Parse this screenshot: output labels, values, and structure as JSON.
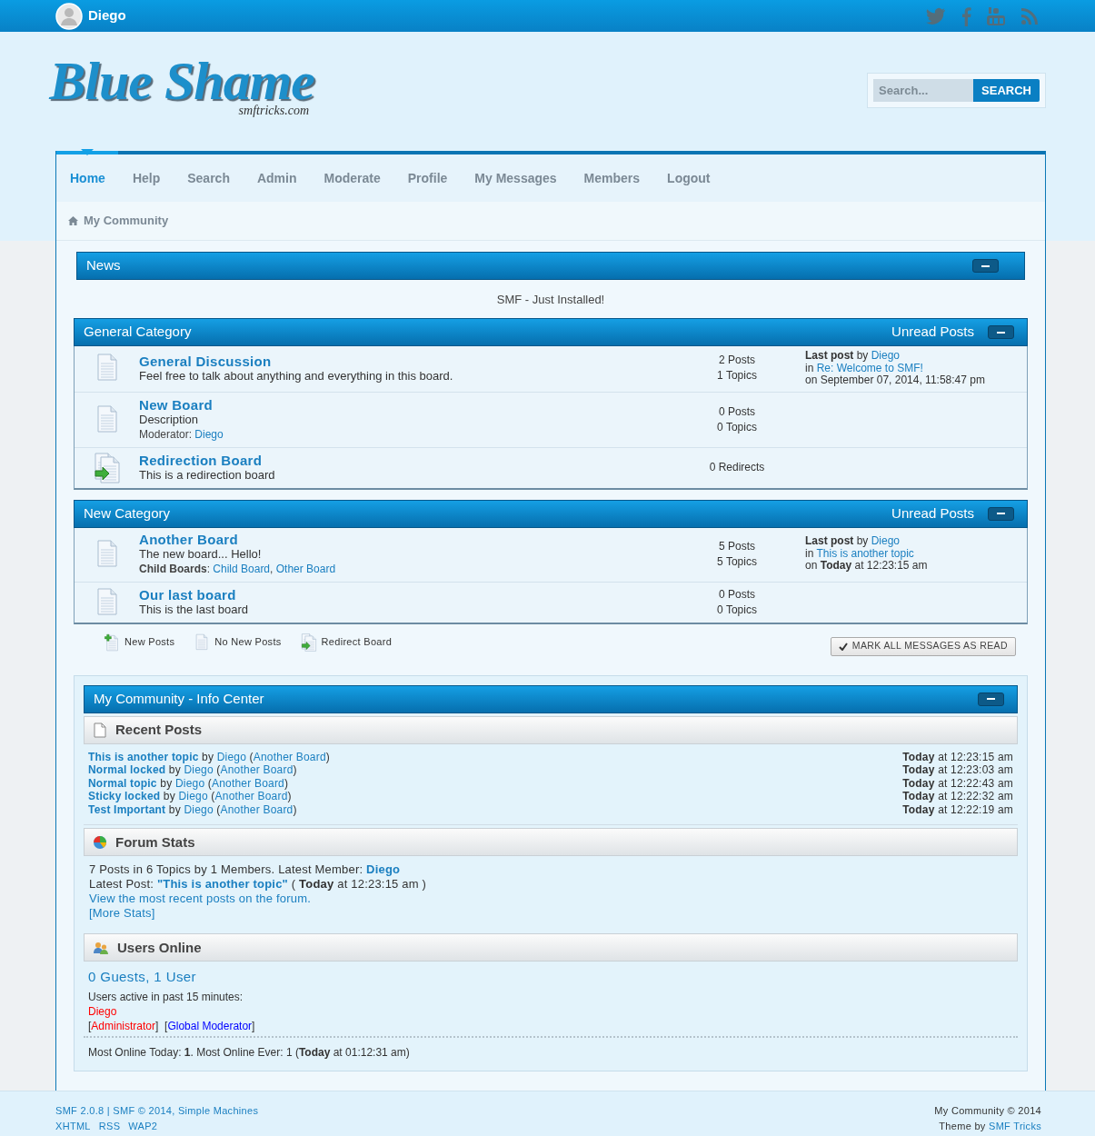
{
  "top_bar": {
    "username": "Diego"
  },
  "logo": {
    "title": "Blue Shame",
    "subtitle": "smftricks.com"
  },
  "search": {
    "placeholder": "Search...",
    "button": "SEARCH"
  },
  "nav": [
    {
      "label": "Home",
      "selected": true
    },
    {
      "label": "Help",
      "selected": false
    },
    {
      "label": "Search",
      "selected": false
    },
    {
      "label": "Admin",
      "selected": false
    },
    {
      "label": "Moderate",
      "selected": false
    },
    {
      "label": "Profile",
      "selected": false
    },
    {
      "label": "My Messages",
      "selected": false
    },
    {
      "label": "Members",
      "selected": false
    },
    {
      "label": "Logout",
      "selected": false
    }
  ],
  "breadcrumb": "My Community",
  "news": {
    "title": "News",
    "text": "SMF - Just Installed!"
  },
  "categories": [
    {
      "title": "General Category",
      "unread": "Unread Posts",
      "boards": [
        {
          "kind": "normal",
          "name": "General Discussion",
          "description": "Feel free to talk about anything and everything in this board.",
          "stats": [
            "2 Posts",
            "1 Topics"
          ],
          "last_post": [
            [
              {
                "text": "Last post",
                "kind": "bold"
              },
              {
                "text": " by ",
                "kind": "text"
              },
              {
                "text": "Diego",
                "kind": "link"
              }
            ],
            [
              {
                "text": "in ",
                "kind": "text"
              },
              {
                "text": "Re: Welcome to SMF!",
                "kind": "link"
              }
            ],
            [
              {
                "text": "on September 07, 2014, 11:58:47 pm",
                "kind": "text"
              }
            ]
          ]
        },
        {
          "kind": "normal",
          "name": "New Board",
          "description": "Description",
          "extra": [
            {
              "text": "Moderator: ",
              "kind": "text"
            },
            {
              "text": "Diego",
              "kind": "link"
            }
          ],
          "stats": [
            "0 Posts",
            "0 Topics"
          ]
        },
        {
          "kind": "redirect",
          "name": "Redirection Board",
          "description": "This is a redirection board",
          "stats": [
            "0 Redirects"
          ]
        }
      ]
    },
    {
      "title": "New Category",
      "unread": "Unread Posts",
      "boards": [
        {
          "kind": "normal",
          "name": "Another Board",
          "description": "The new board... Hello!",
          "extra": [
            {
              "text": "Child Boards",
              "kind": "bold"
            },
            {
              "text": ": ",
              "kind": "text"
            },
            {
              "text": "Child Board",
              "kind": "link"
            },
            {
              "text": ", ",
              "kind": "text"
            },
            {
              "text": "Other Board",
              "kind": "link"
            }
          ],
          "stats": [
            "5 Posts",
            "5 Topics"
          ],
          "last_post": [
            [
              {
                "text": "Last post",
                "kind": "bold"
              },
              {
                "text": " by ",
                "kind": "text"
              },
              {
                "text": "Diego",
                "kind": "link"
              }
            ],
            [
              {
                "text": "in ",
                "kind": "text"
              },
              {
                "text": "This is another topic",
                "kind": "link"
              }
            ],
            [
              {
                "text": "on ",
                "kind": "text"
              },
              {
                "text": "Today",
                "kind": "bold"
              },
              {
                "text": " at 12:23:15 am",
                "kind": "text"
              }
            ]
          ]
        },
        {
          "kind": "normal",
          "name": "Our last board",
          "description": "This is the last board",
          "stats": [
            "0 Posts",
            "0 Topics"
          ]
        }
      ]
    }
  ],
  "legend": [
    {
      "kind": "new",
      "label": "New Posts"
    },
    {
      "kind": "normal",
      "label": "No New Posts"
    },
    {
      "kind": "redirect",
      "label": "Redirect Board"
    }
  ],
  "mark_read": "MARK ALL MESSAGES AS READ",
  "info_center": {
    "title": "My Community - Info Center",
    "sections": [
      {
        "kind": "recent",
        "title": "Recent Posts",
        "posts": [
          {
            "topic": [
              {
                "text": "This is another topic",
                "kind": "linkbold"
              },
              {
                "text": " by ",
                "kind": "text"
              },
              {
                "text": "Diego",
                "kind": "link"
              },
              {
                "text": " (",
                "kind": "text"
              },
              {
                "text": "Another Board",
                "kind": "link"
              },
              {
                "text": ")",
                "kind": "text"
              }
            ],
            "time": [
              {
                "text": "Today",
                "kind": "bold"
              },
              {
                "text": " at 12:23:15 am",
                "kind": "text"
              }
            ]
          },
          {
            "topic": [
              {
                "text": "Normal locked",
                "kind": "linkbold"
              },
              {
                "text": " by ",
                "kind": "text"
              },
              {
                "text": "Diego",
                "kind": "link"
              },
              {
                "text": " (",
                "kind": "text"
              },
              {
                "text": "Another Board",
                "kind": "link"
              },
              {
                "text": ")",
                "kind": "text"
              }
            ],
            "time": [
              {
                "text": "Today",
                "kind": "bold"
              },
              {
                "text": " at 12:23:03 am",
                "kind": "text"
              }
            ]
          },
          {
            "topic": [
              {
                "text": "Normal topic",
                "kind": "linkbold"
              },
              {
                "text": " by ",
                "kind": "text"
              },
              {
                "text": "Diego",
                "kind": "link"
              },
              {
                "text": " (",
                "kind": "text"
              },
              {
                "text": "Another Board",
                "kind": "link"
              },
              {
                "text": ")",
                "kind": "text"
              }
            ],
            "time": [
              {
                "text": "Today",
                "kind": "bold"
              },
              {
                "text": " at 12:22:43 am",
                "kind": "text"
              }
            ]
          },
          {
            "topic": [
              {
                "text": "Sticky locked",
                "kind": "linkbold"
              },
              {
                "text": " by ",
                "kind": "text"
              },
              {
                "text": "Diego",
                "kind": "link"
              },
              {
                "text": " (",
                "kind": "text"
              },
              {
                "text": "Another Board",
                "kind": "link"
              },
              {
                "text": ")",
                "kind": "text"
              }
            ],
            "time": [
              {
                "text": "Today",
                "kind": "bold"
              },
              {
                "text": " at 12:22:32 am",
                "kind": "text"
              }
            ]
          },
          {
            "topic": [
              {
                "text": "Test Important",
                "kind": "linkbold"
              },
              {
                "text": " by ",
                "kind": "text"
              },
              {
                "text": "Diego",
                "kind": "link"
              },
              {
                "text": " (",
                "kind": "text"
              },
              {
                "text": "Another Board",
                "kind": "link"
              },
              {
                "text": ")",
                "kind": "text"
              }
            ],
            "time": [
              {
                "text": "Today",
                "kind": "bold"
              },
              {
                "text": " at 12:22:19 am",
                "kind": "text"
              }
            ]
          }
        ]
      },
      {
        "kind": "stats",
        "title": "Forum Stats",
        "lines": [
          [
            {
              "text": "7 Posts in 6 Topics by 1 Members. Latest Member: ",
              "kind": "text"
            },
            {
              "text": "Diego",
              "kind": "linkbold"
            }
          ],
          [
            {
              "text": "Latest Post: ",
              "kind": "text"
            },
            {
              "text": "\"This is another topic\"",
              "kind": "linkbold"
            },
            {
              "text": " ( ",
              "kind": "text"
            },
            {
              "text": "Today",
              "kind": "bold"
            },
            {
              "text": " at 12:23:15 am )",
              "kind": "text"
            }
          ],
          [
            {
              "text": "View the most recent posts on the forum.",
              "kind": "link"
            }
          ],
          [
            {
              "text": "[More Stats]",
              "kind": "link"
            }
          ]
        ]
      },
      {
        "kind": "users",
        "title": "Users Online",
        "count": "0 Guests, 1 User",
        "active_label": "Users active in past 15 minutes:",
        "users": [
          [
            {
              "text": "Diego",
              "kind": "admin"
            }
          ],
          [
            {
              "text": "[",
              "kind": "text"
            },
            {
              "text": "Administrator",
              "kind": "admin"
            },
            {
              "text": "]  [",
              "kind": "text"
            },
            {
              "text": "Global Moderator",
              "kind": "gmod"
            },
            {
              "text": "]",
              "kind": "text"
            }
          ]
        ],
        "most_online": [
          {
            "text": "Most Online Today: ",
            "kind": "text"
          },
          {
            "text": "1",
            "kind": "bold"
          },
          {
            "text": ". Most Online Ever: 1 (",
            "kind": "text"
          },
          {
            "text": "Today",
            "kind": "bold"
          },
          {
            "text": " at 01:12:31 am)",
            "kind": "text"
          }
        ]
      }
    ]
  },
  "footer": {
    "left": [
      [
        {
          "text": "SMF 2.0.8",
          "kind": "link"
        },
        {
          "text": " | ",
          "kind": "link"
        },
        {
          "text": "SMF © 2014, Simple Machines",
          "kind": "link"
        }
      ],
      [
        {
          "text": "XHTML",
          "kind": "link"
        },
        {
          "text": "RSS",
          "kind": "link"
        },
        {
          "text": "WAP2",
          "kind": "link"
        }
      ]
    ],
    "right": [
      [
        {
          "text": "My Community © 2014",
          "kind": "text"
        }
      ],
      [
        {
          "text": "Theme by ",
          "kind": "text"
        },
        {
          "text": "SMF Tricks",
          "kind": "link"
        }
      ]
    ]
  }
}
